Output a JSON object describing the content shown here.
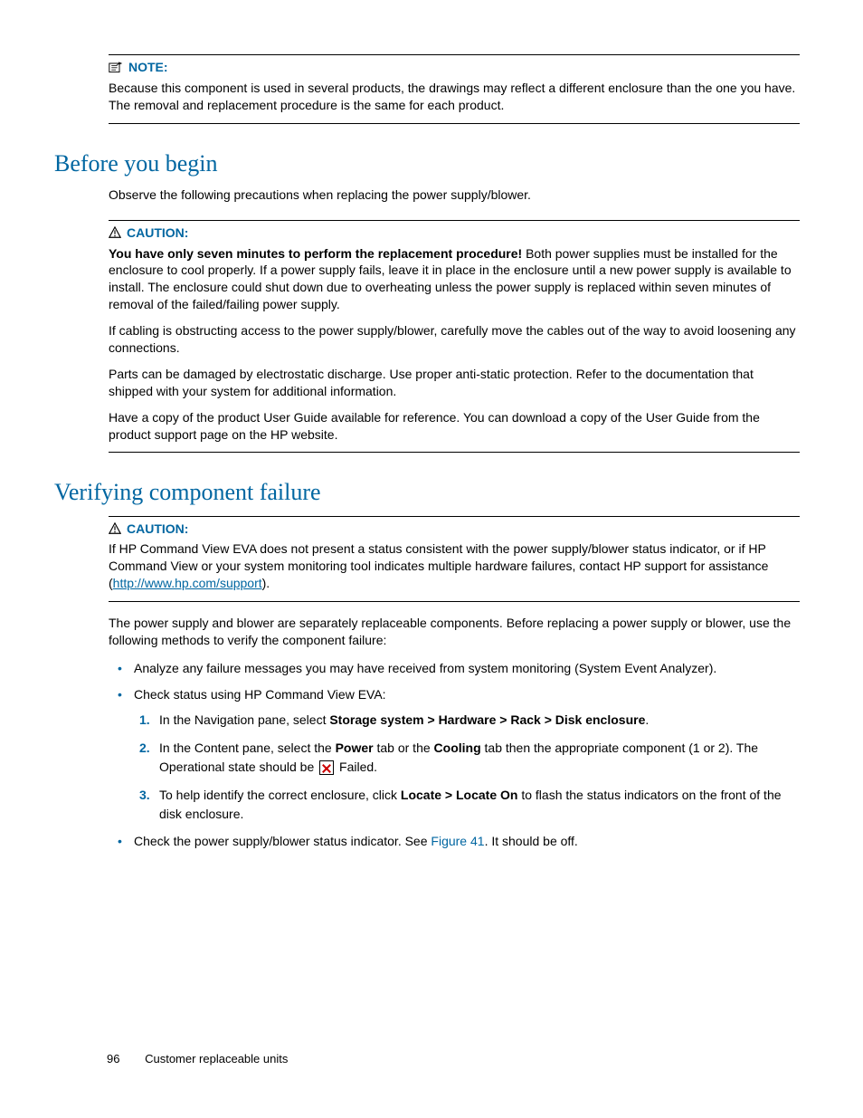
{
  "note": {
    "label": "NOTE:",
    "body": "Because this component is used in several products, the drawings may reflect a different enclosure than the one you have. The removal and replacement procedure is the same for each product."
  },
  "section1": {
    "heading": "Before you begin",
    "intro": "Observe the following precautions when replacing the power supply/blower.",
    "caution": {
      "label": "CAUTION:",
      "p1_bold": "You have only seven minutes to perform the replacement procedure!",
      "p1_rest": " Both power supplies must be installed for the enclosure to cool properly. If a power supply fails, leave it in place in the enclosure until a new power supply is available to install. The enclosure could shut down due to overheating unless the power supply is replaced within seven minutes of removal of the failed/failing power supply.",
      "p2": "If cabling is obstructing access to the power supply/blower, carefully move the cables out of the way to avoid loosening any connections.",
      "p3": "Parts can be damaged by electrostatic discharge. Use proper anti-static protection. Refer to the documentation that shipped with your system for additional information.",
      "p4": "Have a copy of the product User Guide available for reference. You can download a copy of the User Guide from the product support page on the HP website."
    }
  },
  "section2": {
    "heading": "Verifying component failure",
    "caution": {
      "label": "CAUTION:",
      "p1_a": "If HP Command View EVA does not present a status consistent with the power supply/blower status indicator, or if HP Command View or your system monitoring tool indicates multiple hardware failures, contact HP support for assistance (",
      "link": "http://www.hp.com/support",
      "p1_b": ")."
    },
    "body": "The power supply and blower are separately replaceable components. Before replacing a power supply or blower, use the following methods to verify the component failure:",
    "bullets": {
      "b1": "Analyze any failure messages you may have received from system monitoring (System Event Analyzer).",
      "b2": "Check status using HP Command View EVA:",
      "b3_a": "Check the power supply/blower status indicator. See ",
      "b3_ref": "Figure 41",
      "b3_b": ". It should be off."
    },
    "steps": {
      "s1_a": "In the Navigation pane, select ",
      "s1_bold": "Storage system > Hardware > Rack > Disk enclosure",
      "s1_b": ".",
      "s2_a": "In the Content pane, select the ",
      "s2_bold1": "Power",
      "s2_mid": " tab or the ",
      "s2_bold2": "Cooling",
      "s2_b": " tab then the appropriate component (1 or 2). The Operational state should be ",
      "s2_c": " Failed.",
      "s3_a": "To help identify the correct enclosure, click ",
      "s3_bold": "Locate > Locate On",
      "s3_b": " to flash the status indicators on the front of the disk enclosure."
    }
  },
  "footer": {
    "page": "96",
    "title": "Customer replaceable units"
  }
}
